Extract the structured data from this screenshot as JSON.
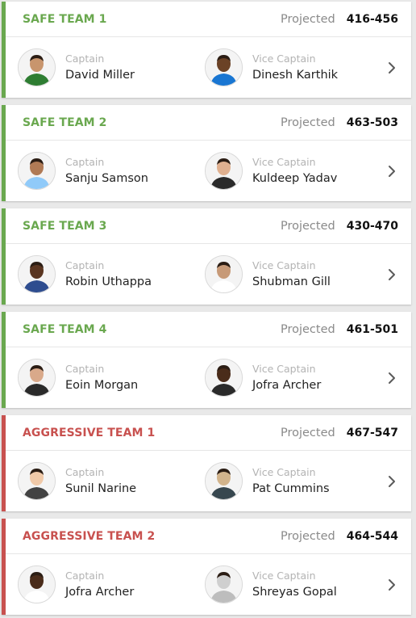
{
  "colors": {
    "safe": "#6aa84f",
    "aggressive": "#c8514f"
  },
  "icons": {
    "row_action": "chevron-right-icon",
    "avatar": "player-avatar"
  },
  "teams": [
    {
      "name": "SAFE TEAM 1",
      "type": "safe",
      "projected_label": "Projected",
      "projected_value": "416-456",
      "captain_label": "Captain",
      "captain": "David Miller",
      "vice_label": "Vice Captain",
      "vice_captain": "Dinesh Karthik"
    },
    {
      "name": "SAFE TEAM 2",
      "type": "safe",
      "projected_label": "Projected",
      "projected_value": "463-503",
      "captain_label": "Captain",
      "captain": "Sanju Samson",
      "vice_label": "Vice Captain",
      "vice_captain": "Kuldeep Yadav"
    },
    {
      "name": "SAFE TEAM 3",
      "type": "safe",
      "projected_label": "Projected",
      "projected_value": "430-470",
      "captain_label": "Captain",
      "captain": "Robin Uthappa",
      "vice_label": "Vice Captain",
      "vice_captain": "Shubman Gill"
    },
    {
      "name": "SAFE TEAM 4",
      "type": "safe",
      "projected_label": "Projected",
      "projected_value": "461-501",
      "captain_label": "Captain",
      "captain": "Eoin Morgan",
      "vice_label": "Vice Captain",
      "vice_captain": "Jofra Archer"
    },
    {
      "name": "AGGRESSIVE TEAM 1",
      "type": "aggressive",
      "projected_label": "Projected",
      "projected_value": "467-547",
      "captain_label": "Captain",
      "captain": "Sunil Narine",
      "vice_label": "Vice Captain",
      "vice_captain": "Pat Cummins"
    },
    {
      "name": "AGGRESSIVE TEAM 2",
      "type": "aggressive",
      "projected_label": "Projected",
      "projected_value": "464-544",
      "captain_label": "Captain",
      "captain": "Jofra Archer",
      "vice_label": "Vice Captain",
      "vice_captain": "Shreyas Gopal"
    }
  ]
}
